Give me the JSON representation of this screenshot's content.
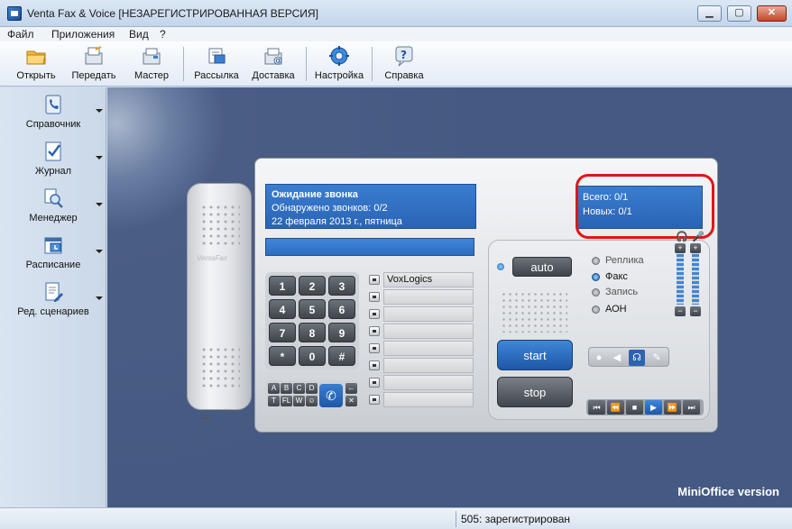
{
  "window": {
    "title": "Venta Fax & Voice [НЕЗАРЕГИСТРИРОВАННАЯ ВЕРСИЯ]"
  },
  "menu": [
    "Файл",
    "Приложения",
    "Вид",
    "?"
  ],
  "toolbar": [
    "Открыть",
    "Передать",
    "Мастер",
    "Рассылка",
    "Доставка",
    "Настройка",
    "Справка"
  ],
  "sidebar": [
    "Справочник",
    "Журнал",
    "Менеджер",
    "Расписание",
    "Ред. сценариев"
  ],
  "device": {
    "logo": "VentaFax",
    "status_line1": "Ожидание звонка",
    "status_line2": "Обнаружено звонков: 0/2",
    "status_line3": "22 февраля 2013 г., пятница",
    "counter_total": "Всего:  0/1",
    "counter_new": "Новых:  0/1",
    "keys": [
      "1",
      "2",
      "3",
      "4",
      "5",
      "6",
      "7",
      "8",
      "9",
      "*",
      "0",
      "#"
    ],
    "letters": [
      "A",
      "B",
      "C",
      "D",
      "T",
      "FL",
      "W",
      "☺"
    ],
    "memory_first": "VoxLogics",
    "auto_label": "auto",
    "start_label": "start",
    "stop_label": "stop",
    "modes": [
      "Реплика",
      "Факс",
      "Запись",
      "АОН"
    ],
    "active_mode": "Факс"
  },
  "brand": "MiniOffice version",
  "statusbar": {
    "text": "505: зарегистрирован"
  }
}
